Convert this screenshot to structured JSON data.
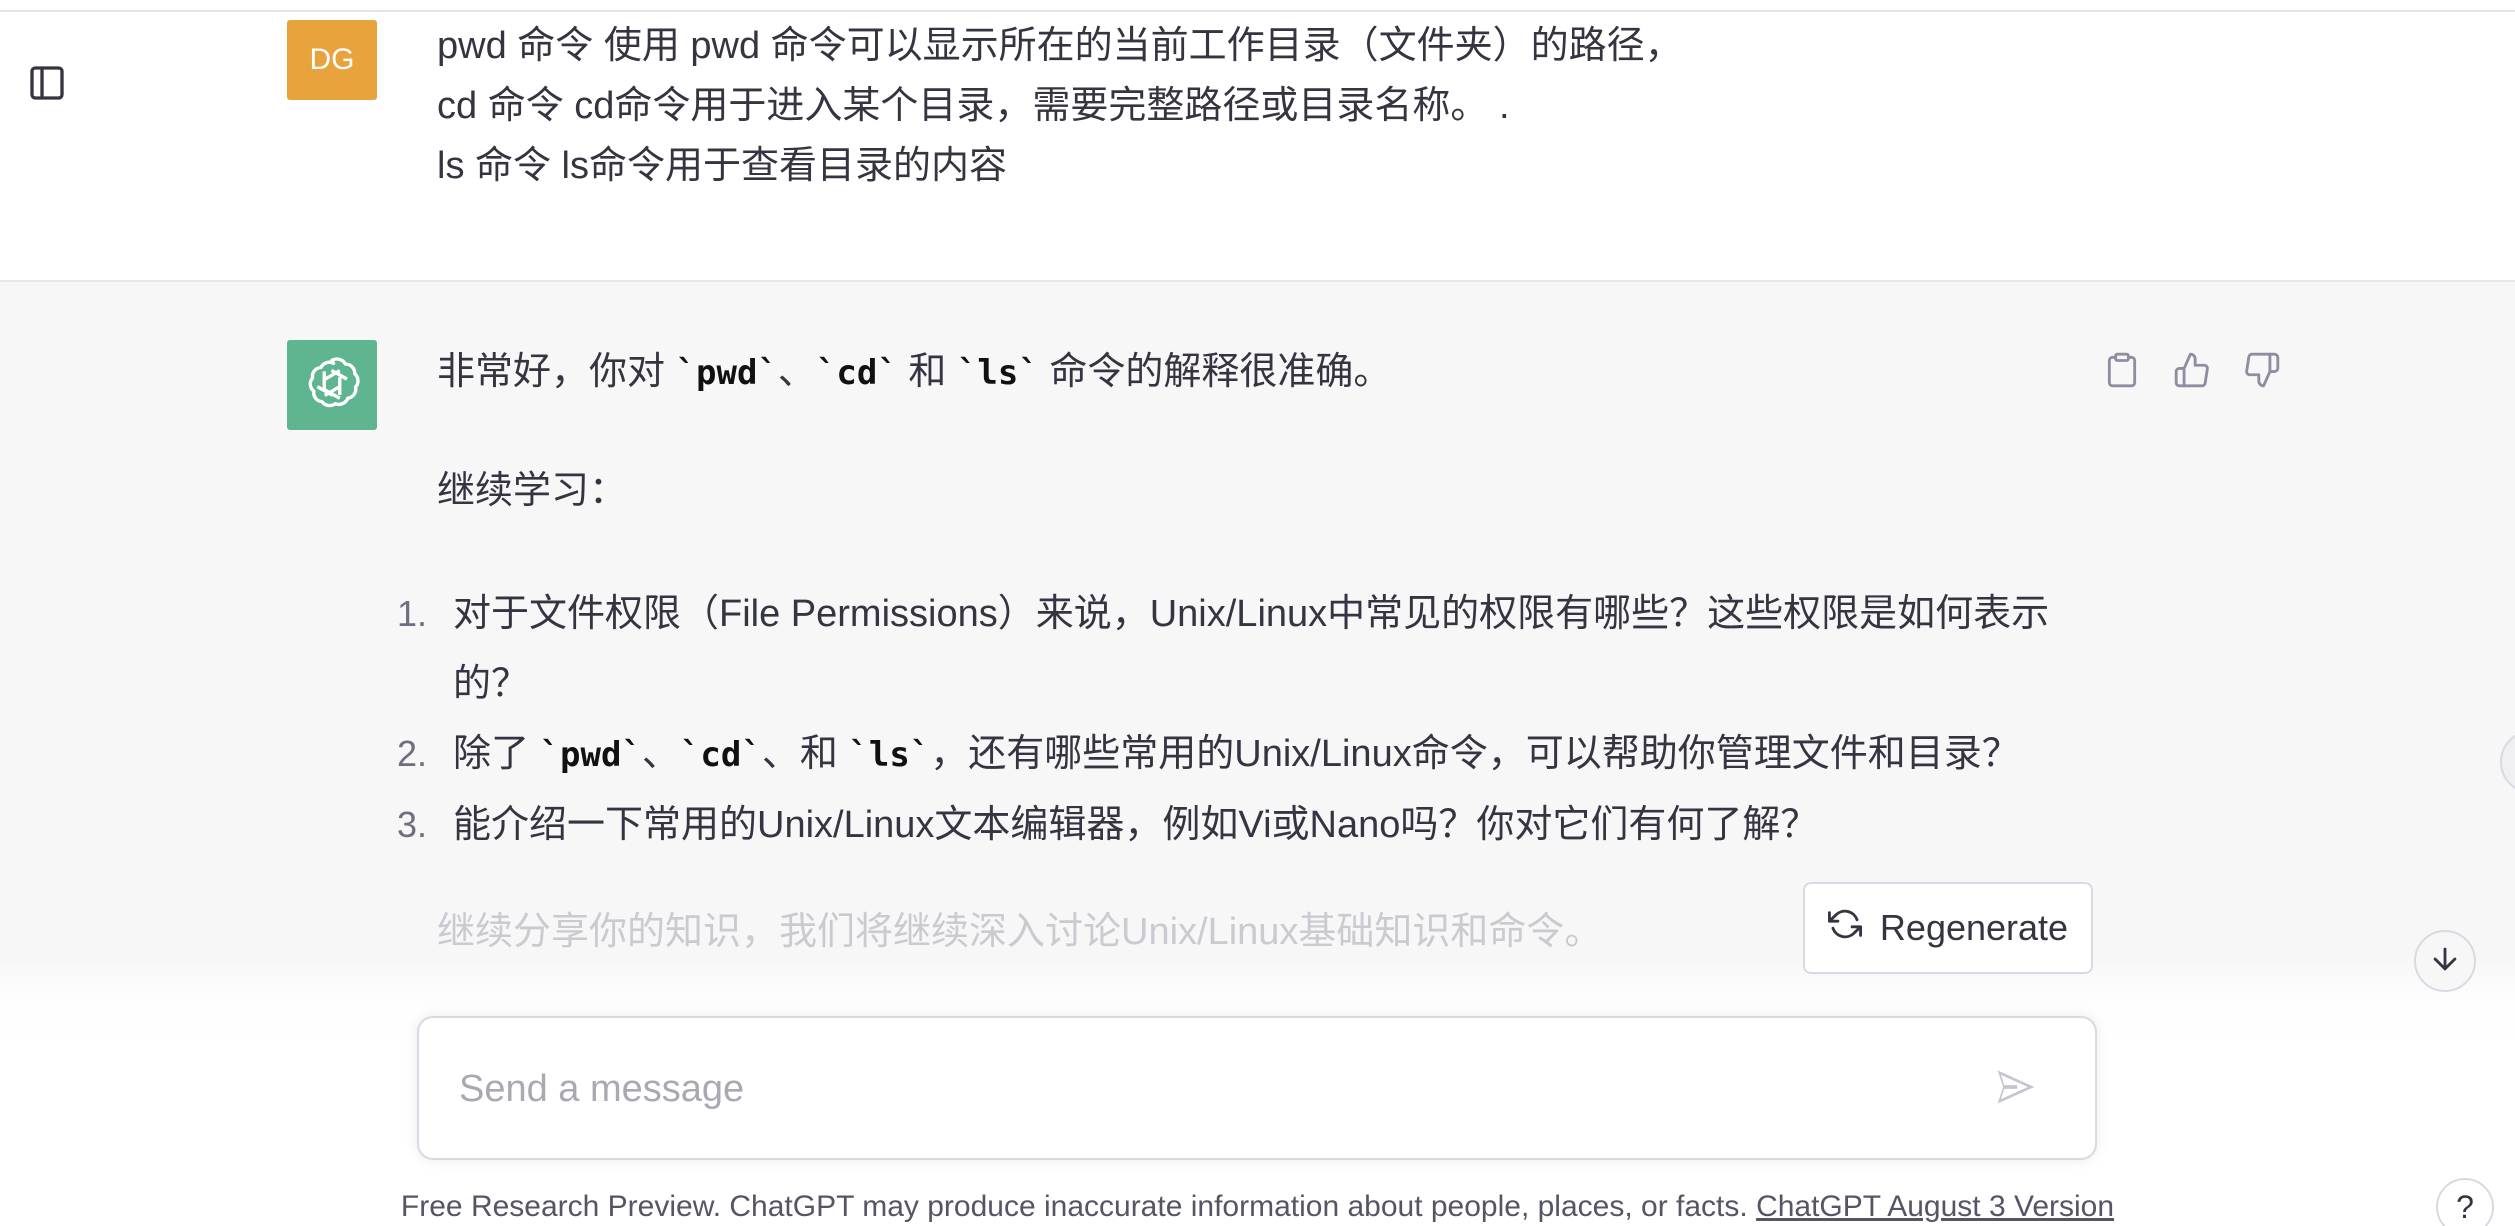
{
  "user": {
    "avatar_initials": "DG",
    "avatar_color": "#e8a33d",
    "lines": [
      "pwd 命令 使用 pwd 命令可以显示所在的当前工作目录（文件夹）的路径，",
      "cd 命令 cd命令用于进入某个目录，需要完整路径或目录名称。 .",
      "ls 命令 ls命令用于查看目录的内容"
    ]
  },
  "assistant": {
    "avatar_icon": "openai-logo-icon",
    "avatar_color": "#5fb58f",
    "intro": {
      "before": "非常好，你对 ",
      "code1": "`pwd`",
      "sep1": "、",
      "code2": "`cd`",
      "sep2": " 和 ",
      "code3": "`ls`",
      "after": " 命令的解释很准确。"
    },
    "continue_label": "继续学习：",
    "questions": [
      {
        "num": "1.",
        "text": "对于文件权限（File Permissions）来说，Unix/Linux中常见的权限有哪些？这些权限是如何表示的？"
      },
      {
        "num": "2.",
        "before": "除了 ",
        "code1": "`pwd`",
        "sep1": "、",
        "code2": "`cd`",
        "sep2": "、和 ",
        "code3": "`ls`",
        "after": "，还有哪些常用的Unix/Linux命令，可以帮助你管理文件和目录？"
      },
      {
        "num": "3.",
        "text": "能介绍一下常用的Unix/Linux文本编辑器，例如Vi或Nano吗？你对它们有何了解？"
      }
    ],
    "closing": "继续分享你的知识，我们将继续深入讨论Unix/Linux基础知识和命令。",
    "actions": [
      "clipboard-icon",
      "thumbs-up-icon",
      "thumbs-down-icon"
    ]
  },
  "regenerate_label": "Regenerate",
  "composer": {
    "placeholder": "Send a message"
  },
  "footer": {
    "text": "Free Research Preview. ChatGPT may produce inaccurate information about people, places, or facts. ",
    "link": "ChatGPT August 3 Version"
  },
  "help_label": "?"
}
